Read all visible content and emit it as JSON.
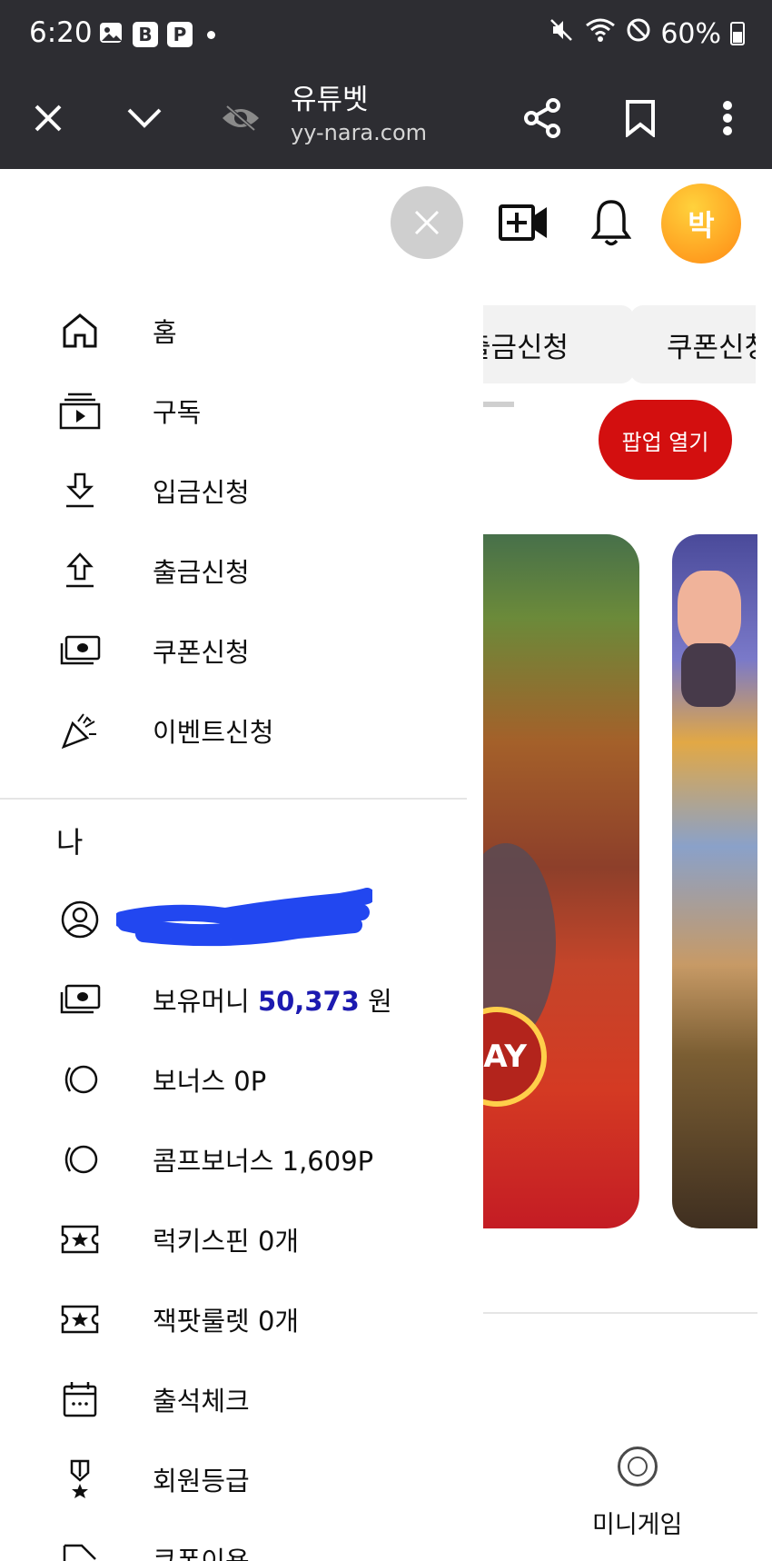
{
  "status_bar": {
    "time": "6:20",
    "notif_b": "B",
    "notif_p": "P",
    "battery": "60%"
  },
  "browser": {
    "title": "유튜벳",
    "url": "yy-nara.com"
  },
  "header": {
    "avatar_initial": "박"
  },
  "chips": [
    {
      "label": "출금신청"
    },
    {
      "label": "쿠폰신청"
    }
  ],
  "popup_button": "팝업 열기",
  "card_badge_text": "AY",
  "drawer": {
    "nav": [
      {
        "label": "홈",
        "icon": "home-icon"
      },
      {
        "label": "구독",
        "icon": "subscriptions-icon"
      },
      {
        "label": "입금신청",
        "icon": "download-icon"
      },
      {
        "label": "출금신청",
        "icon": "upload-icon"
      },
      {
        "label": "쿠폰신청",
        "icon": "cash-icon"
      },
      {
        "label": "이벤트신청",
        "icon": "party-popper-icon"
      }
    ],
    "section_me": "나",
    "me_items": [
      {
        "label_prefix": "보유머니 ",
        "amount": "50,373",
        "label_suffix": " 원",
        "icon": "cash-icon"
      },
      {
        "label": "보너스 0P",
        "icon": "coins-icon"
      },
      {
        "label": "콤프보너스 1,609P",
        "icon": "coins-icon"
      },
      {
        "label": "럭키스핀 0개",
        "icon": "ticket-icon"
      },
      {
        "label": "잭팟룰렛 0개",
        "icon": "ticket-icon"
      },
      {
        "label": "출석체크",
        "icon": "calendar-icon"
      },
      {
        "label": "회원등급",
        "icon": "medal-icon"
      },
      {
        "label": "쿠폰이용",
        "icon": "coupon-icon"
      }
    ]
  },
  "bottom": {
    "minigame_label": "미니게임"
  },
  "colors": {
    "browser_bg": "#2d2d32",
    "popup_red": "#d30f0f",
    "money_blue": "#1c1ab0",
    "scribble_blue": "#2247f0"
  }
}
